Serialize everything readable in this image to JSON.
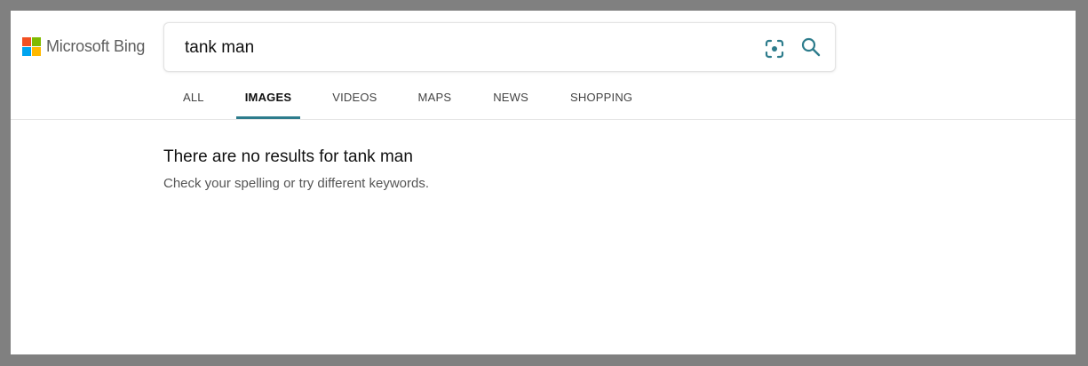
{
  "brand": {
    "name": "Microsoft Bing"
  },
  "search": {
    "query": "tank man",
    "visual_search_icon": "visual-search-icon",
    "search_icon": "search-icon"
  },
  "tabs": [
    {
      "label": "ALL",
      "active": false
    },
    {
      "label": "IMAGES",
      "active": true
    },
    {
      "label": "VIDEOS",
      "active": false
    },
    {
      "label": "MAPS",
      "active": false
    },
    {
      "label": "NEWS",
      "active": false
    },
    {
      "label": "SHOPPING",
      "active": false
    }
  ],
  "results": {
    "title": "There are no results for tank man",
    "hint": "Check your spelling or try different keywords."
  },
  "colors": {
    "accent": "#2d7c8c",
    "ms_red": "#f25022",
    "ms_green": "#7fba00",
    "ms_blue": "#00a4ef",
    "ms_yellow": "#ffb900"
  }
}
